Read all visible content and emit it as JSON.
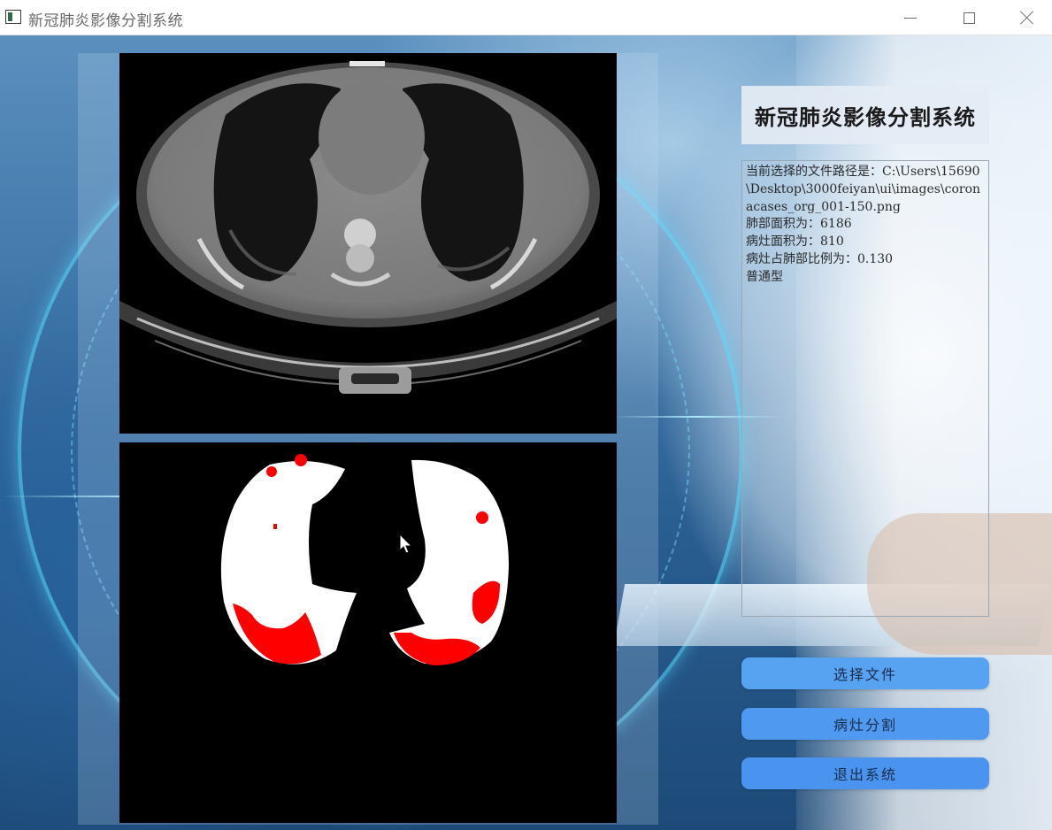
{
  "window": {
    "title": "新冠肺炎影像分割系统"
  },
  "panel": {
    "title": "新冠肺炎影像分割系统",
    "info_lines": [
      "当前选择的文件路径是：C:\\Users\\15690\\Desktop\\3000feiyan\\ui\\images\\coronacases_org_001-150.png",
      "肺部面积为：6186",
      "病灶面积为：810",
      "病灶占肺部比例为：0.130",
      "普通型"
    ]
  },
  "buttons": {
    "select_file": "选择文件",
    "segment": "病灶分割",
    "exit": "退出系统"
  },
  "colors": {
    "button": "#4e9af0",
    "lesion": "#ff0000",
    "lung_mask": "#ffffff"
  },
  "icons": {
    "app": "app-icon",
    "minimize": "minimize-icon",
    "maximize": "maximize-icon",
    "close": "close-icon"
  }
}
